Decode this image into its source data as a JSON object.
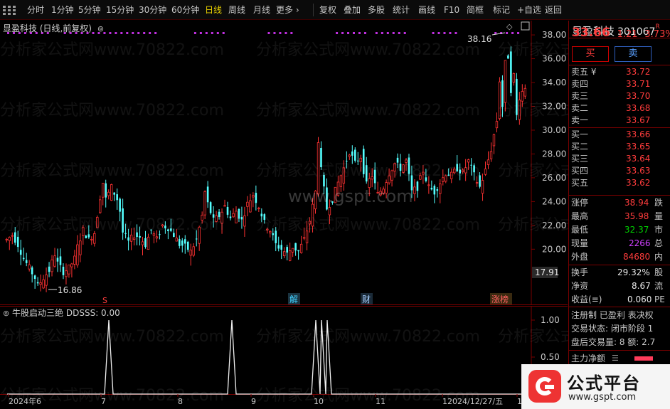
{
  "toolbar": {
    "items": [
      "分时",
      "1分钟",
      "5分钟",
      "15分钟",
      "30分钟",
      "60分钟",
      "日线",
      "周线",
      "月线",
      "更多 ›",
      "复权",
      "叠加",
      "多股",
      "统计",
      "画线",
      "F10",
      "简框",
      "标记",
      "+自选",
      "返回"
    ],
    "active_item": "日线"
  },
  "main_chart": {
    "title": "显盈科技 (日线,前复权)",
    "high_label": "38.16",
    "low_label": "16.86",
    "current_price_tag": "17.91",
    "event_markers": [
      "S",
      "解",
      "财",
      "涨榜"
    ]
  },
  "indicator": {
    "title": "牛股启动三绝  DDSSS: 0.00",
    "y_ticks": [
      "1.00",
      "0.50"
    ]
  },
  "watermark": {
    "text": "分析家公式网www.70822.com",
    "center_text": "www.gspt.com"
  },
  "quote": {
    "name": "显盈科技",
    "code": "301067",
    "badge": "R",
    "price": "33.66",
    "change": "1.21",
    "change_pct": "3.73%",
    "buy_label": "买",
    "sell_label": "卖",
    "asks": [
      {
        "label": "卖五 ¥",
        "price": "33.72"
      },
      {
        "label": "卖四",
        "price": "33.71"
      },
      {
        "label": "卖三",
        "price": "33.70"
      },
      {
        "label": "卖二",
        "price": "33.68"
      },
      {
        "label": "卖一",
        "price": "33.67"
      }
    ],
    "bids": [
      {
        "label": "买一",
        "price": "33.66"
      },
      {
        "label": "买二",
        "price": "33.65"
      },
      {
        "label": "买三",
        "price": "33.64"
      },
      {
        "label": "买四",
        "price": "33.63"
      },
      {
        "label": "买五",
        "price": "33.62"
      }
    ],
    "stats1": [
      {
        "label": "涨停",
        "value": "38.94",
        "cut": "跌"
      },
      {
        "label": "最高",
        "value": "35.98",
        "cut": "量"
      },
      {
        "label": "最低",
        "value": "32.37",
        "cut": "市"
      },
      {
        "label": "现量",
        "value": "2266",
        "cut": "总"
      },
      {
        "label": "外盘",
        "value": "84680",
        "cut": "内"
      }
    ],
    "stats2": [
      {
        "label": "换手",
        "value": "29.32%",
        "cut": "股"
      },
      {
        "label": "净资",
        "value": "8.67",
        "cut": "流"
      },
      {
        "label": "收益(≡)",
        "value": "0.060",
        "cut": "PE"
      }
    ],
    "info_lines": [
      "注册制 已盈利 表决权",
      "交易状态: 闭市阶段 1",
      "盘后交易量: 8  额: 2.7"
    ],
    "main_flow_label": "主力净额"
  },
  "logo": {
    "title": "公式平台",
    "url": "www.gspt.com"
  },
  "chart_data": {
    "type": "candlestick",
    "title": "显盈科技 (日线,前复权)",
    "y_axis": {
      "ticks": [
        20,
        22,
        24,
        26,
        28,
        30,
        32,
        34,
        36,
        38
      ],
      "range": [
        15.3,
        39.2
      ]
    },
    "x_axis": {
      "labels": [
        "2024年6",
        "7",
        "8",
        "9",
        "10",
        "11",
        "12024/12/27/五",
        "1"
      ]
    },
    "series": [
      {
        "name": "日线",
        "close_path": [
          [
            0,
            20.8
          ],
          [
            2,
            21.2
          ],
          [
            4,
            20.4
          ],
          [
            6,
            19.2
          ],
          [
            8,
            18.4
          ],
          [
            10,
            17.6
          ],
          [
            11,
            16.9
          ],
          [
            13,
            17.6
          ],
          [
            15,
            18.2
          ],
          [
            17,
            19.6
          ],
          [
            18,
            18.8
          ],
          [
            20,
            18.1
          ],
          [
            22,
            18.4
          ],
          [
            24,
            19.2
          ],
          [
            25,
            20.2
          ],
          [
            27,
            21.6
          ],
          [
            29,
            20.8
          ],
          [
            31,
            21.4
          ],
          [
            33,
            24.4
          ],
          [
            34,
            25.6
          ],
          [
            35,
            24.2
          ],
          [
            37,
            25.2
          ],
          [
            39,
            24.2
          ],
          [
            40,
            23.2
          ],
          [
            41,
            21.4
          ],
          [
            43,
            20.6
          ],
          [
            45,
            21.2
          ],
          [
            47,
            21.0
          ],
          [
            49,
            20.4
          ],
          [
            51,
            21.6
          ],
          [
            53,
            20.8
          ],
          [
            55,
            22.0
          ],
          [
            57,
            21.8
          ],
          [
            59,
            21.2
          ],
          [
            61,
            20.4
          ],
          [
            63,
            20.2
          ],
          [
            65,
            19.8
          ],
          [
            67,
            20.8
          ],
          [
            69,
            22.8
          ],
          [
            70,
            24.8
          ],
          [
            71,
            23.8
          ],
          [
            73,
            22.4
          ],
          [
            75,
            22.8
          ],
          [
            77,
            23.6
          ],
          [
            79,
            22.6
          ],
          [
            81,
            23.2
          ],
          [
            83,
            22.4
          ],
          [
            85,
            23.8
          ],
          [
            87,
            24.6
          ],
          [
            89,
            23.6
          ],
          [
            91,
            22.2
          ],
          [
            93,
            21.6
          ],
          [
            95,
            20.4
          ],
          [
            97,
            20.0
          ],
          [
            99,
            19.6
          ],
          [
            101,
            20.2
          ],
          [
            103,
            19.8
          ],
          [
            105,
            20.8
          ],
          [
            107,
            22.4
          ],
          [
            109,
            24.8
          ],
          [
            110,
            29.2
          ],
          [
            111,
            26.6
          ],
          [
            113,
            23.4
          ],
          [
            115,
            24.2
          ],
          [
            117,
            25.6
          ],
          [
            119,
            26.8
          ],
          [
            121,
            28.2
          ],
          [
            123,
            27.2
          ],
          [
            125,
            27.8
          ],
          [
            127,
            25.4
          ],
          [
            129,
            26.2
          ],
          [
            131,
            24.6
          ],
          [
            133,
            25.2
          ],
          [
            135,
            26.4
          ],
          [
            137,
            27.2
          ],
          [
            139,
            26.8
          ],
          [
            141,
            27.4
          ],
          [
            143,
            24.8
          ],
          [
            145,
            25.2
          ],
          [
            147,
            26.6
          ],
          [
            149,
            25.2
          ],
          [
            151,
            24.8
          ],
          [
            153,
            25.6
          ],
          [
            155,
            26.4
          ],
          [
            157,
            26.2
          ],
          [
            159,
            26.8
          ],
          [
            161,
            26.4
          ],
          [
            163,
            27.4
          ],
          [
            165,
            26.2
          ],
          [
            167,
            25.2
          ],
          [
            169,
            26.6
          ],
          [
            171,
            28.4
          ],
          [
            173,
            30.8
          ],
          [
            174,
            34.2
          ],
          [
            175,
            32.0
          ],
          [
            176,
            35.6
          ],
          [
            177,
            36.2
          ],
          [
            178,
            33.4
          ],
          [
            179,
            34.6
          ],
          [
            180,
            31.2
          ],
          [
            181,
            32.8
          ],
          [
            183,
            33.66
          ]
        ],
        "total_bars": 184
      }
    ]
  }
}
